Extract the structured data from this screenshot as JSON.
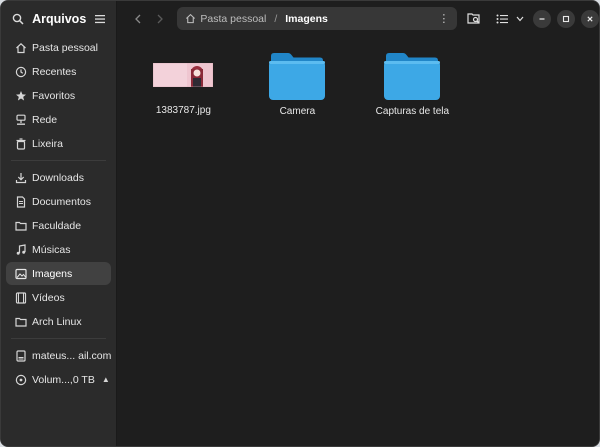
{
  "sidebar": {
    "title": "Arquivos",
    "items": [
      {
        "label": "Pasta pessoal",
        "icon": "home-icon"
      },
      {
        "label": "Recentes",
        "icon": "clock-icon"
      },
      {
        "label": "Favoritos",
        "icon": "star-icon"
      },
      {
        "label": "Rede",
        "icon": "network-icon"
      },
      {
        "label": "Lixeira",
        "icon": "trash-icon"
      }
    ],
    "places": [
      {
        "label": "Downloads",
        "icon": "download-icon"
      },
      {
        "label": "Documentos",
        "icon": "document-icon"
      },
      {
        "label": "Faculdade",
        "icon": "folder-icon"
      },
      {
        "label": "Músicas",
        "icon": "music-icon"
      },
      {
        "label": "Imagens",
        "icon": "image-icon",
        "active": true
      },
      {
        "label": "Vídeos",
        "icon": "video-icon"
      },
      {
        "label": "Arch Linux",
        "icon": "folder-icon"
      }
    ],
    "devices": [
      {
        "label": "mateus...  ail.com",
        "icon": "account-drive-icon"
      },
      {
        "label": "Volum...,0 TB",
        "icon": "drive-icon"
      }
    ]
  },
  "path": {
    "home": "Pasta pessoal",
    "current": "Imagens"
  },
  "files": [
    {
      "name": "1383787.jpg",
      "type": "image"
    },
    {
      "name": "Camera",
      "type": "folder"
    },
    {
      "name": "Capturas de tela",
      "type": "folder"
    }
  ],
  "colors": {
    "folder": "#3da8e6",
    "folder_dark": "#2186c8",
    "active_item": "#414141"
  }
}
